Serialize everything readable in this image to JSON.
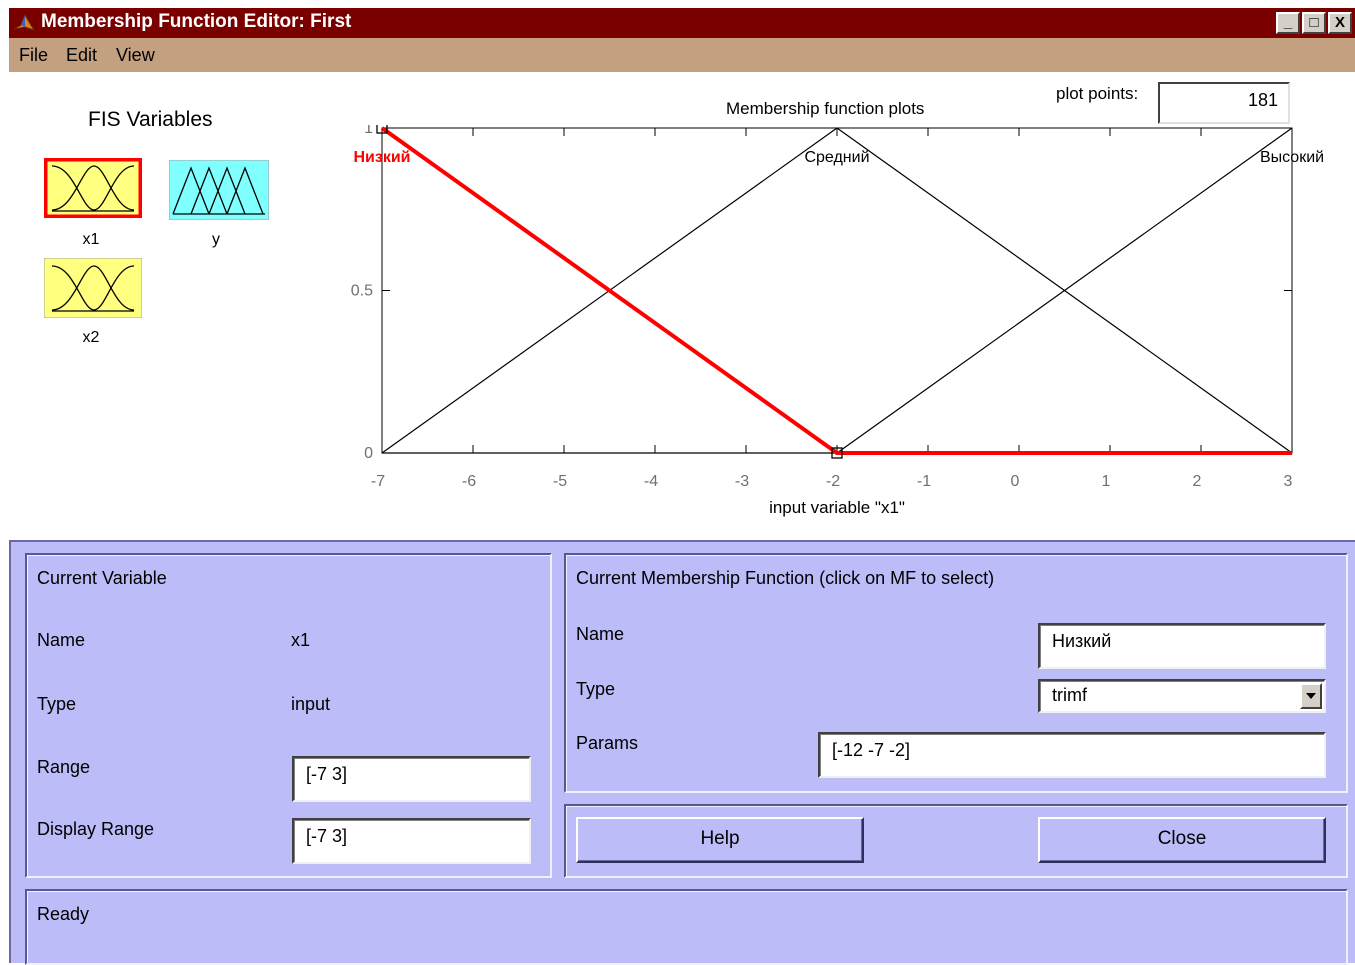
{
  "window": {
    "title": "Membership Function Editor: First",
    "controls": [
      "_",
      "□",
      "X"
    ],
    "title_bar_color": "#7a0000",
    "menu_bar_color": "#c3a07f"
  },
  "menu": [
    "File",
    "Edit",
    "View"
  ],
  "fis_variables": {
    "title": "FIS Variables",
    "items": [
      {
        "label": "x1",
        "kind": "input",
        "color": "#ffff80",
        "selected": true
      },
      {
        "label": "y",
        "kind": "output",
        "color": "#80ffff",
        "selected": false
      },
      {
        "label": "x2",
        "kind": "input",
        "color": "#ffff80",
        "selected": false
      }
    ]
  },
  "plot": {
    "title": "Membership function plots",
    "plot_points_label": "plot points:",
    "plot_points_value": "181",
    "xlabel": "input variable \"x1\""
  },
  "chart_data": {
    "type": "line",
    "xlabel": "input variable \"x1\"",
    "xlim": [
      -7,
      3
    ],
    "ylim": [
      0,
      1
    ],
    "xticks": [
      "-7",
      "-6",
      "-5",
      "-4",
      "-3",
      "-2",
      "-1",
      "0",
      "1",
      "2",
      "3"
    ],
    "yticks": [
      "0",
      "0.5",
      "1"
    ],
    "series": [
      {
        "name": "Низкий",
        "x": [
          -7,
          -2,
          3
        ],
        "y": [
          1,
          0,
          0
        ],
        "selected": true,
        "color": "#ff0000",
        "label_at": -7
      },
      {
        "name": "Средний",
        "x": [
          -7,
          -2,
          3
        ],
        "y": [
          0,
          1,
          0
        ],
        "selected": false,
        "color": "#000000",
        "label_at": -2
      },
      {
        "name": "Высокий",
        "x": [
          -7,
          -2,
          3
        ],
        "y": [
          0,
          0,
          1
        ],
        "selected": false,
        "color": "#000000",
        "label_at": 3
      }
    ]
  },
  "current_variable": {
    "title": "Current Variable",
    "name_label": "Name",
    "name_value": "x1",
    "type_label": "Type",
    "type_value": "input",
    "range_label": "Range",
    "range_value": "[-7 3]",
    "display_range_label": "Display Range",
    "display_range_value": "[-7 3]"
  },
  "current_mf": {
    "title": "Current Membership Function (click on MF to select)",
    "name_label": "Name",
    "name_value": "Низкий",
    "type_label": "Type",
    "type_value": "trimf",
    "params_label": "Params",
    "params_value": "[-12 -7 -2]"
  },
  "buttons": {
    "help": "Help",
    "close": "Close"
  },
  "status": "Ready",
  "panel_color": "#bcbcf8"
}
